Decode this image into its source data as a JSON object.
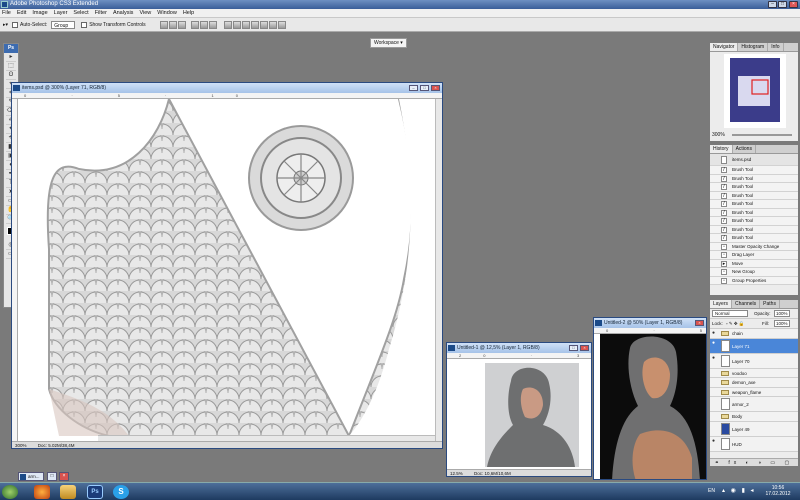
{
  "app": {
    "title": "Adobe Photoshop CS3 Extended"
  },
  "menu": [
    "File",
    "Edit",
    "Image",
    "Layer",
    "Select",
    "Filter",
    "Analysis",
    "View",
    "Window",
    "Help"
  ],
  "options": {
    "auto_select_label": "Auto-Select:",
    "auto_select_value": "Group",
    "show_transform": "Show Transform Controls",
    "workspace": "Workspace ▾"
  },
  "toolbox": {
    "header": "Ps",
    "tools": [
      "▸",
      "⬚",
      "ʘ",
      "⌖",
      "⌗",
      "✎",
      "⌫",
      "✐",
      "✦",
      "⟲",
      "◧",
      "▣",
      "◐",
      "✒",
      "T",
      "➤",
      "▭",
      "✋",
      "🔍"
    ]
  },
  "doc_main": {
    "title": "items.psd @ 300% (Layer 71, RGB/8)",
    "zoom": "300%",
    "doc": "Doc: 5.02M/38,4M"
  },
  "doc_u1": {
    "title": "Untitled-1 @ 12,5% (Layer 1, RGB/8)",
    "zoom": "12.5%",
    "doc": "Doc: 10,6M/10,6M"
  },
  "doc_u2": {
    "title": "Untitled-2 @ 50% (Layer 1, RGB/8)"
  },
  "navigator": {
    "tabs": [
      "Navigator",
      "Histogram",
      "Info"
    ],
    "zoom": "300%"
  },
  "history": {
    "tabs": [
      "History",
      "Actions"
    ],
    "snapshot": "items.psd",
    "items": [
      "Brush Tool",
      "Brush Tool",
      "Brush Tool",
      "Brush Tool",
      "Brush Tool",
      "Brush Tool",
      "Brush Tool",
      "Brush Tool",
      "Brush Tool",
      "Master Opacity Change",
      "Drag Layer",
      "Move",
      "New Group",
      "Group Properties"
    ]
  },
  "layers": {
    "tabs": [
      "Layers",
      "Channels",
      "Paths"
    ],
    "blend": "Normal",
    "opacity_label": "Opacity:",
    "opacity": "100%",
    "lock_label": "Lock:",
    "fill_label": "Fill:",
    "fill": "100%",
    "items": [
      "chain",
      "Layer 71",
      "Layer 70",
      "voodoo",
      "demon_axe",
      "weapon_flame",
      "armor_2",
      "Body",
      "Layer 49",
      "HUD"
    ]
  },
  "taskbar": {
    "minimized": "arm...",
    "lang": "EN",
    "time": "10:56",
    "date": "17.02.2012"
  },
  "colors": {
    "accent": "#4a86d8",
    "selection": "#4a86d8"
  }
}
